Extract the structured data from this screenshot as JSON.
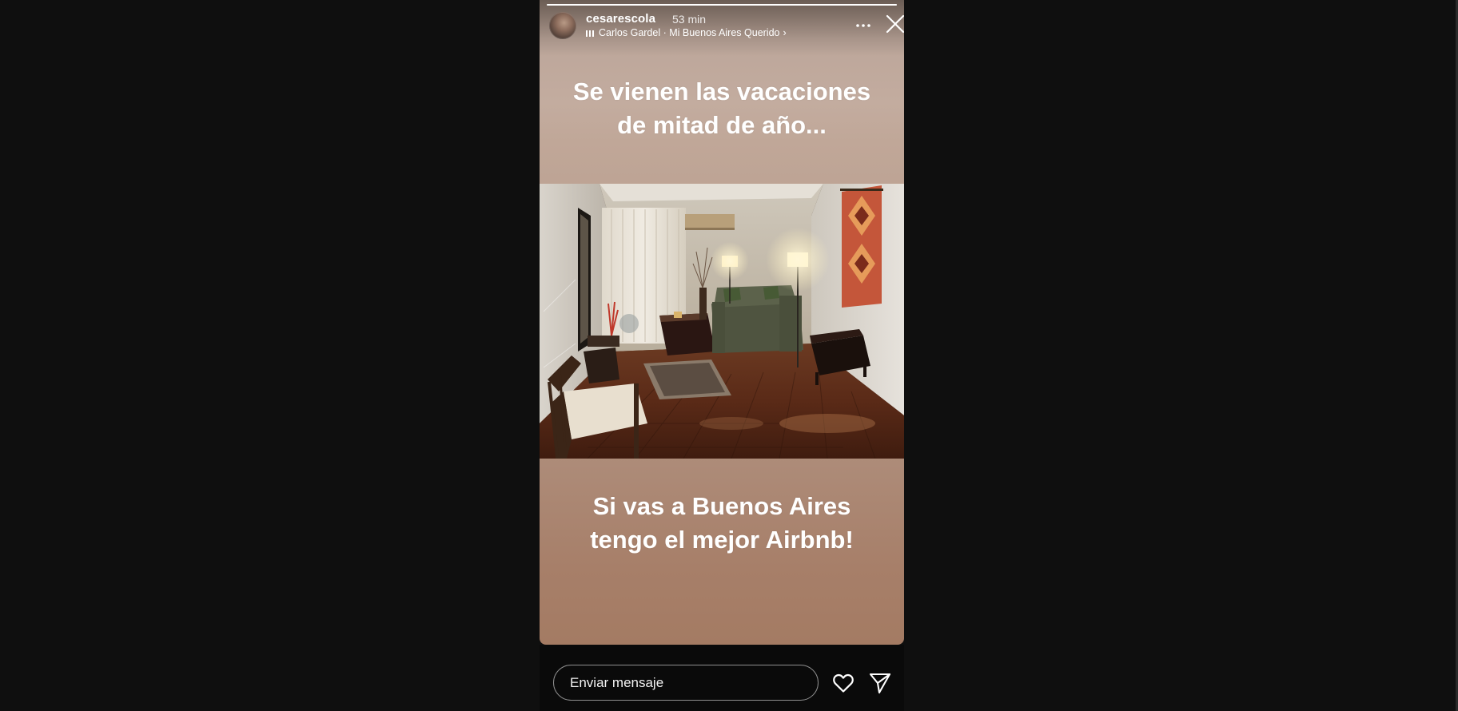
{
  "story": {
    "username": "cesarescola",
    "time_ago": "53 min",
    "music": {
      "label": "Carlos Gardel · Mi Buenos Aires Querido",
      "chevron": "›"
    },
    "progress": 1.0,
    "caption_top": [
      "Se vienen las vacaciones",
      "de mitad de año..."
    ],
    "caption_bottom": [
      "Si vas a Buenos Aires",
      "tengo el mejor Airbnb!"
    ]
  },
  "reply": {
    "placeholder": "Enviar mensaje"
  },
  "icons": {
    "more": "more-horizontal-icon",
    "close": "close-icon",
    "like": "heart-icon",
    "share": "paper-plane-icon",
    "music": "music-bars-icon"
  },
  "colors": {
    "background": "#0f0f0f",
    "story_top": "#c3ac9f",
    "story_bottom": "#a47b63",
    "text": "#ffffff"
  }
}
